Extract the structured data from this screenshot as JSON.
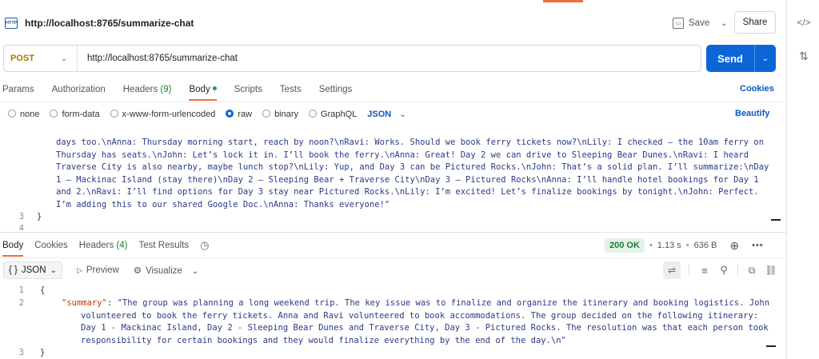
{
  "request": {
    "title": "http://localhost:8765/summarize-chat",
    "http_badge": "HTTP",
    "save_label": "Save",
    "share_label": "Share",
    "method": "POST",
    "url": "http://localhost:8765/summarize-chat",
    "send_label": "Send"
  },
  "request_tabs": {
    "params": "Params",
    "authorization": "Authorization",
    "headers": "Headers",
    "headers_count": "(9)",
    "body": "Body",
    "scripts": "Scripts",
    "tests": "Tests",
    "settings": "Settings",
    "cookies": "Cookies"
  },
  "body_options": {
    "none": "none",
    "form_data": "form-data",
    "urlencoded": "x-www-form-urlencoded",
    "raw": "raw",
    "binary": "binary",
    "graphql": "GraphQL",
    "format": "JSON",
    "beautify": "Beautify"
  },
  "request_body": {
    "lines": [
      "days too.\\nAnna: Thursday morning start, reach by noon?\\nRavi: Works. Should we book ferry tickets now?\\nLily: I checked — the 10am ferry on",
      "Thursday has seats.\\nJohn: Let’s lock it in. I’ll book the ferry.\\nAnna: Great! Day 2 we can drive to Sleeping Bear Dunes.\\nRavi: I heard",
      "Traverse City is also nearby, maybe lunch stop?\\nLily: Yup, and Day 3 can be Pictured Rocks.\\nJohn: That’s a solid plan. I’ll summarize:\\nDay",
      "1 – Mackinac Island (stay there)\\nDay 2 – Sleeping Bear + Traverse City\\nDay 3 – Pictured Rocks\\nAnna: I’ll handle hotel bookings for Day 1",
      "and 2.\\nRavi: I’ll find options for Day 3 stay near Pictured Rocks.\\nLily: I’m excited! Let’s finalize bookings by tonight.\\nJohn: Perfect.",
      "I’m adding this to our shared Google Doc.\\nAnna: Thanks everyone!\""
    ],
    "closing_line_number": "3",
    "closing_brace": "}",
    "next_line_number": "4"
  },
  "response_tabs": {
    "body": "Body",
    "cookies": "Cookies",
    "headers": "Headers",
    "headers_count": "(4)",
    "test_results": "Test Results"
  },
  "response_meta": {
    "status": "200 OK",
    "time": "1.13 s",
    "size": "636 B",
    "dot": "•"
  },
  "response_toolbar": {
    "format": "JSON",
    "format_prefix": "{ }",
    "preview": "Preview",
    "visualize": "Visualize"
  },
  "response_body": {
    "line1_number": "1",
    "line1": "{",
    "line2_number": "2",
    "key": "\"summary\"",
    "colon": ": ",
    "value_lines": [
      "\"The group was planning a long weekend trip. The key issue was to finalize and organize the itinerary and booking logistics. John",
      "volunteered to book the ferry tickets. Anna and Ravi volunteered to book accommodations. The group decided on the following itinerary:",
      "Day 1 - Mackinac Island, Day 2 - Sleeping Bear Dunes and Traverse City, Day 3 - Pictured Rocks. The resolution was that each person took",
      "responsibility for certain bookings and they would finalize everything by the end of the day.\\n\""
    ],
    "line3_number": "3",
    "line3": "}"
  },
  "colors": {
    "accent_orange": "#f26b3a",
    "send_blue": "#0a66d6",
    "status_green": "#1e7e34",
    "status_bg": "#e3f3e6",
    "json_key": "#c43a0a",
    "json_string": "#2b3a86"
  }
}
